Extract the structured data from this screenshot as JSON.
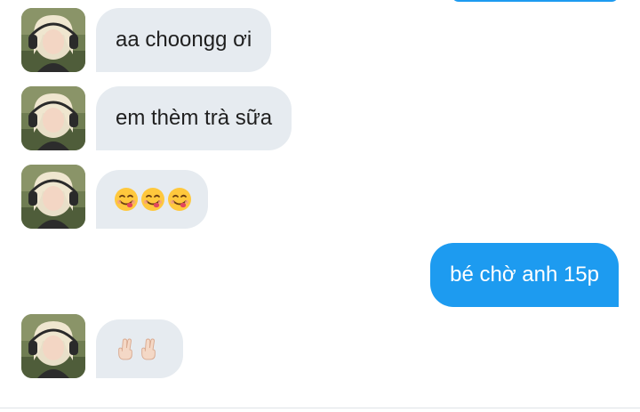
{
  "conversation": {
    "messages": [
      {
        "sender": "other",
        "text": "aa choongg ơi"
      },
      {
        "sender": "other",
        "text": "em thèm trà sữa"
      },
      {
        "sender": "other",
        "emojis": [
          "face-savoring-food-icon",
          "face-savoring-food-icon",
          "face-savoring-food-icon"
        ]
      },
      {
        "sender": "me",
        "text": "bé chờ anh 15p"
      },
      {
        "sender": "other",
        "emojis": [
          "crossed-fingers-icon",
          "crossed-fingers-icon"
        ]
      }
    ]
  },
  "colors": {
    "incoming_bubble": "#e6ebf0",
    "outgoing_bubble": "#1d9bf0",
    "incoming_text": "#1f1f1f",
    "outgoing_text": "#ffffff"
  }
}
